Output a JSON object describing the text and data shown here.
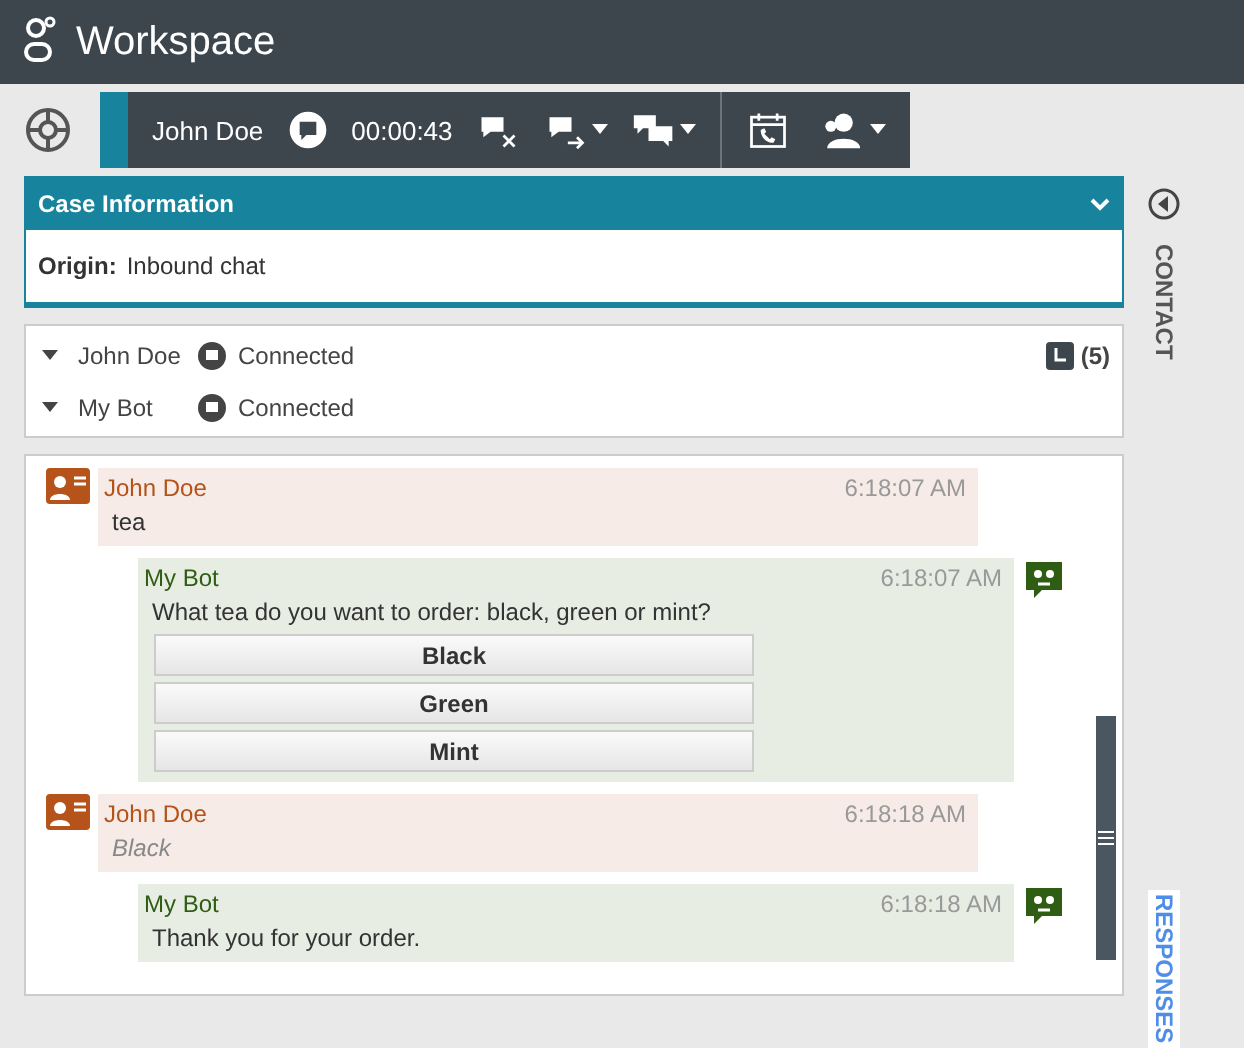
{
  "window": {
    "title": "Workspace"
  },
  "interaction": {
    "contact": "John Doe",
    "timer": "00:00:43"
  },
  "case_information": {
    "title": "Case Information",
    "expanded": true,
    "field_label": "Origin:",
    "field_value": "Inbound chat"
  },
  "participants": [
    {
      "name": "John Doe",
      "status": "Connected"
    },
    {
      "name": "My Bot",
      "status": "Connected"
    }
  ],
  "pending_count": "(5)",
  "messages": [
    {
      "kind": "customer",
      "sender": "John Doe",
      "time": "6:18:07 AM",
      "text": "tea",
      "italic": false
    },
    {
      "kind": "bot",
      "sender": "My Bot",
      "time": "6:18:07 AM",
      "text": "What tea do you want to order: black, green or mint?",
      "options": [
        "Black",
        "Green",
        "Mint"
      ]
    },
    {
      "kind": "customer",
      "sender": "John Doe",
      "time": "6:18:18 AM",
      "text": "Black",
      "italic": true
    },
    {
      "kind": "bot",
      "sender": "My Bot",
      "time": "6:18:18 AM",
      "text": "Thank you for your order."
    }
  ],
  "side_tabs": [
    {
      "label": "CONTACT",
      "kind": "contact"
    },
    {
      "label": "RESPONSES",
      "kind": "responses"
    }
  ]
}
